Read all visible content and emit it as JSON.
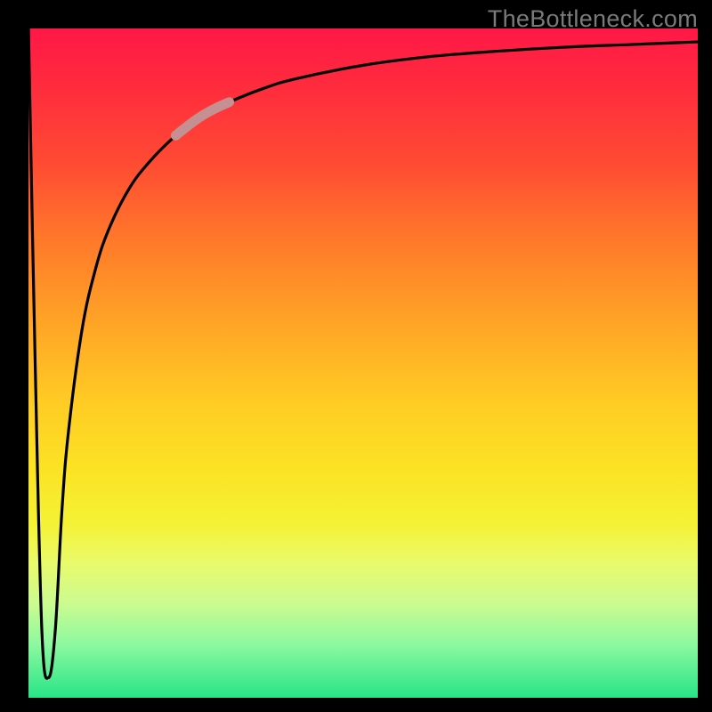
{
  "watermark": "TheBottleneck.com",
  "chart_data": {
    "type": "line",
    "title": "",
    "xlabel": "",
    "ylabel": "",
    "xlim": [
      0,
      100
    ],
    "ylim": [
      0,
      100
    ],
    "grid": false,
    "legend": false,
    "gradient_background": {
      "top": "#ff1846",
      "bottom": "#28e487",
      "meaning": "bottleneck severity (top=high, bottom=none)"
    },
    "series": [
      {
        "name": "bottleneck-curve",
        "color": "#000000",
        "x": [
          0,
          1,
          2,
          3,
          4,
          5,
          6,
          8,
          10,
          12,
          15,
          18,
          22,
          26,
          30,
          35,
          40,
          50,
          60,
          70,
          80,
          90,
          100
        ],
        "y": [
          100,
          50,
          10,
          3,
          10,
          28,
          40,
          55,
          64,
          70,
          76,
          80,
          84,
          87,
          89,
          91,
          92.5,
          94.5,
          95.8,
          96.6,
          97.2,
          97.6,
          98
        ]
      },
      {
        "name": "highlight-segment",
        "color": "#c49091",
        "x": [
          22,
          24,
          26,
          28,
          30
        ],
        "y": [
          84,
          85.6,
          87,
          88.1,
          89
        ]
      }
    ],
    "annotations": []
  }
}
